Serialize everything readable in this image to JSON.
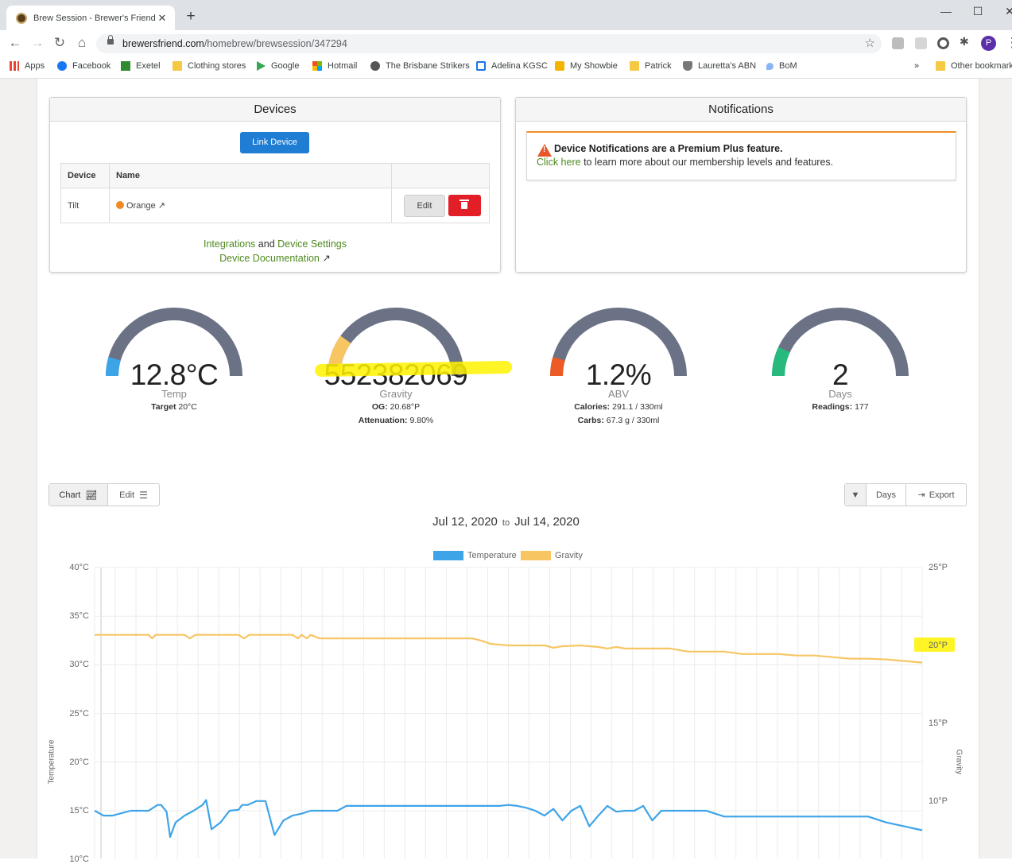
{
  "browser": {
    "tab_title": "Brew Session - Brewer's Friend",
    "tab_close": "✕",
    "new_tab": "+",
    "url_host": "brewersfriend.com",
    "url_path": "/homebrew/brewsession/347294",
    "avatar_initial": "P",
    "bookmarks": [
      {
        "label": "Apps",
        "icon": "apps-grid-icon",
        "color": "#ea4335"
      },
      {
        "label": "Facebook",
        "icon": "facebook-icon",
        "color": "#1877f2"
      },
      {
        "label": "Exetel",
        "icon": "exetel-icon",
        "color": "#2e8b2e"
      },
      {
        "label": "Clothing stores",
        "icon": "folder-icon",
        "color": "#f6c944"
      },
      {
        "label": "Google",
        "icon": "google-play-icon",
        "color": "#34a853"
      },
      {
        "label": "Hotmail",
        "icon": "microsoft-icon",
        "color": "#f25022"
      },
      {
        "label": "The Brisbane Strikers",
        "icon": "ball-icon",
        "color": "#555555"
      },
      {
        "label": "Adelina KGSC",
        "icon": "school-icon",
        "color": "#1a73e8"
      },
      {
        "label": "My Showbie",
        "icon": "showbie-icon",
        "color": "#f4b400"
      },
      {
        "label": "Patrick",
        "icon": "folder-icon",
        "color": "#f6c944"
      },
      {
        "label": "Lauretta's ABN",
        "icon": "crest-icon",
        "color": "#555555"
      },
      {
        "label": "BoM",
        "icon": "bom-icon",
        "color": "#8ab4f8"
      }
    ],
    "more_bookmarks": "»",
    "other_bookmarks": "Other bookmarks"
  },
  "devices": {
    "title": "Devices",
    "link_button": "Link Device",
    "col_device": "Device",
    "col_name": "Name",
    "rows": [
      {
        "device": "Tilt",
        "name": "Orange"
      }
    ],
    "edit_label": "Edit",
    "integrations": "Integrations",
    "and_text": "and",
    "device_settings": "Device Settings",
    "documentation": "Device Documentation"
  },
  "notifications": {
    "title": "Notifications",
    "alert_title": "Device Notifications are a Premium Plus feature.",
    "click_here": "Click here",
    "alert_text": "to learn more about our membership levels and features."
  },
  "gauges": [
    {
      "value": "12.8°C",
      "label": "Temp",
      "subs": [
        {
          "k": "Target",
          "v": "20°C"
        }
      ],
      "color": "#3ea4e8",
      "fill_fraction": 0.09
    },
    {
      "value": "552382069",
      "label": "Gravity",
      "subs": [
        {
          "k": "OG:",
          "v": "20.68°P"
        },
        {
          "k": "Attenuation:",
          "v": "9.80%"
        }
      ],
      "color": "#f7c663",
      "fill_fraction": 0.2
    },
    {
      "value": "1.2%",
      "label": "ABV",
      "subs": [
        {
          "k": "Calories:",
          "v": "291.1 / 330ml"
        },
        {
          "k": "Carbs:",
          "v": "67.3 g / 330ml"
        }
      ],
      "color": "#ec5a26",
      "fill_fraction": 0.09
    },
    {
      "value": "2",
      "label": "Days",
      "subs": [
        {
          "k": "Readings:",
          "v": "177"
        }
      ],
      "color": "#27b97d",
      "fill_fraction": 0.14
    }
  ],
  "gauge_track_color": "#6b7285",
  "chart_controls": {
    "chart_tab": "Chart",
    "edit_tab": "Edit",
    "days_label": "Days",
    "export_label": "Export"
  },
  "date_range": {
    "from": "Jul 12, 2020",
    "to_word": "to",
    "to": "Jul 14, 2020"
  },
  "chart_data": {
    "type": "line",
    "title": "",
    "series": [
      {
        "name": "Temperature",
        "axis": "left",
        "color": "#3ea4e8",
        "x": [
          0,
          0.5,
          1,
          2,
          2.5,
          3,
          3.5,
          3.7,
          4,
          4.2,
          4.5,
          5,
          5.5,
          6,
          6.2,
          6.5,
          7,
          7.5,
          8,
          8.2,
          8.5,
          9,
          9.5,
          10,
          10.5,
          11,
          11.5,
          12,
          12.5,
          13,
          13.5,
          14,
          14.5,
          15,
          15.5,
          16,
          16.5,
          17,
          17.5,
          18,
          18.5,
          19,
          19.5,
          20,
          20.5,
          21,
          21.5,
          22,
          22.5,
          23,
          23.5,
          24,
          24.5,
          25,
          25.5,
          26,
          26.5,
          27,
          27.5,
          28,
          28.5,
          29,
          29.5,
          30,
          30.5,
          31,
          31.5,
          32,
          32.5,
          33,
          33.5,
          34,
          35,
          36,
          37,
          38,
          39,
          40,
          41,
          42,
          43,
          44,
          45,
          46
        ],
        "y": [
          15,
          14.5,
          14.5,
          15,
          15,
          15,
          15.6,
          15.6,
          14.9,
          12.3,
          13.8,
          14.5,
          15,
          15.6,
          16.1,
          13.1,
          13.8,
          15,
          15.1,
          15.6,
          15.6,
          16,
          16,
          12.5,
          14,
          14.5,
          14.7,
          15,
          15,
          15,
          15,
          15.5,
          15.5,
          15.5,
          15.5,
          15.5,
          15.5,
          15.5,
          15.5,
          15.5,
          15.5,
          15.5,
          15.5,
          15.5,
          15.5,
          15.5,
          15.5,
          15.5,
          15.5,
          15.6,
          15.5,
          15.3,
          15,
          14.5,
          15.2,
          14,
          15,
          15.5,
          13.4,
          14.5,
          15.5,
          14.9,
          15,
          15,
          15.5,
          14,
          15,
          15,
          15,
          15,
          15,
          15,
          14.4,
          14.4,
          14.4,
          14.4,
          14.4,
          14.4,
          14.4,
          14.4,
          14.4,
          13.8,
          13.4,
          13.0
        ]
      },
      {
        "name": "Gravity",
        "axis": "right",
        "color": "#f7c663",
        "x": [
          0,
          2,
          3,
          3.2,
          3.4,
          4,
          5,
          5.3,
          5.6,
          6,
          7,
          8,
          8.3,
          8.6,
          9,
          10,
          11,
          11.3,
          11.5,
          11.8,
          12,
          12.5,
          13,
          14,
          15,
          16,
          17,
          18,
          19,
          20,
          21,
          21.5,
          22,
          23,
          24,
          25,
          25.5,
          26,
          27,
          28,
          28.5,
          29,
          29.5,
          30,
          31,
          32,
          33,
          34,
          35,
          36,
          37,
          38,
          39,
          40,
          41,
          42,
          43,
          44,
          45,
          46
        ],
        "y": [
          20.68,
          20.68,
          20.68,
          20.45,
          20.68,
          20.68,
          20.68,
          20.45,
          20.68,
          20.68,
          20.68,
          20.68,
          20.45,
          20.68,
          20.68,
          20.68,
          20.68,
          20.45,
          20.68,
          20.45,
          20.68,
          20.45,
          20.45,
          20.45,
          20.45,
          20.45,
          20.45,
          20.45,
          20.45,
          20.45,
          20.45,
          20.3,
          20.1,
          20.0,
          20.0,
          20.0,
          19.85,
          19.95,
          20.0,
          19.9,
          19.8,
          19.9,
          19.8,
          19.8,
          19.8,
          19.8,
          19.6,
          19.6,
          19.6,
          19.45,
          19.45,
          19.45,
          19.35,
          19.35,
          19.25,
          19.15,
          19.15,
          19.1,
          19.0,
          18.9
        ]
      }
    ],
    "x_range": [
      0,
      46
    ],
    "y_left": {
      "label": "Temperature",
      "range": [
        10,
        40
      ],
      "ticks": [
        "40°C",
        "35°C",
        "30°C",
        "25°C",
        "20°C",
        "15°C",
        "10°C"
      ]
    },
    "y_right": {
      "label": "Gravity",
      "range": [
        5,
        25
      ],
      "ticks": [
        "25°P",
        "20°P",
        "15°P",
        "10°P"
      ]
    },
    "grid": true,
    "legend": "top-center"
  }
}
